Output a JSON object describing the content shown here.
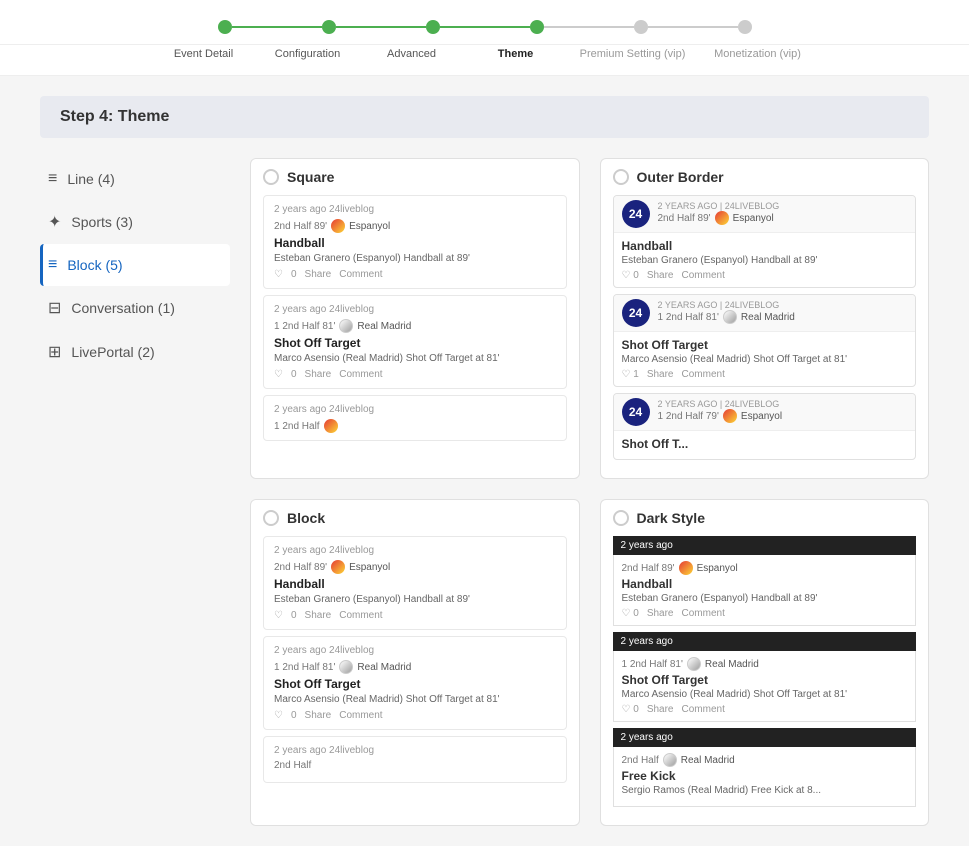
{
  "stepper": {
    "steps": [
      {
        "label": "Event Detail",
        "active": true,
        "connector": true,
        "connector_active": true
      },
      {
        "label": "Configuration",
        "active": true,
        "connector": true,
        "connector_active": true
      },
      {
        "label": "Advanced",
        "active": true,
        "connector": true,
        "connector_active": true
      },
      {
        "label": "Theme",
        "active": true,
        "connector": true,
        "connector_active": false
      },
      {
        "label": "Premium Setting (vip)",
        "active": false,
        "connector": true,
        "connector_active": false
      },
      {
        "label": "Monetization (vip)",
        "active": false,
        "connector": false
      }
    ]
  },
  "step_header": "Step 4: Theme",
  "sidebar": {
    "items": [
      {
        "icon": "≡",
        "label": "Line (4)",
        "active": false
      },
      {
        "icon": "✦",
        "label": "Sports (3)",
        "active": false
      },
      {
        "icon": "≡",
        "label": "Block (5)",
        "active": true
      },
      {
        "icon": "⊟",
        "label": "Conversation (1)",
        "active": false
      },
      {
        "icon": "⊞",
        "label": "LivePortal (2)",
        "active": false
      }
    ]
  },
  "themes": [
    {
      "id": "square",
      "name": "Square",
      "selected": false,
      "posts": [
        {
          "meta": "2 years ago   24liveblog",
          "half": "2nd Half 89'",
          "team": "Espanyol",
          "team_type": "espanyol",
          "title": "Handball",
          "desc": "Esteban Granero (Espanyol) Handball at 89'",
          "likes": "0",
          "actions": [
            "Share",
            "Comment"
          ]
        },
        {
          "meta": "2 years ago   24liveblog",
          "half": "1 2nd Half 81'",
          "team": "Real Madrid",
          "team_type": "rm",
          "title": "Shot Off Target",
          "desc": "Marco Asensio (Real Madrid) Shot Off Target at 81'",
          "likes": "0",
          "actions": [
            "Share",
            "Comment"
          ]
        },
        {
          "meta": "2 years ago   24liveblog",
          "half": "1 2nd Half",
          "team": "Espanyol",
          "team_type": "espanyol",
          "title": "...",
          "desc": "",
          "likes": "",
          "actions": []
        }
      ]
    },
    {
      "id": "outer-border",
      "name": "Outer Border",
      "selected": false,
      "posts": [
        {
          "badge": "24",
          "meta": "2 YEARS AGO | 24LIVEBLOG",
          "half": "2nd Half 89'",
          "team": "Espanyol",
          "team_type": "espanyol",
          "title": "Handball",
          "desc": "Esteban Granero (Espanyol) Handball at 89'",
          "likes": "0",
          "actions": [
            "Share",
            "Comment"
          ]
        },
        {
          "badge": "24",
          "meta": "2 YEARS AGO | 24LIVEBLOG",
          "half": "1 2nd Half 81'",
          "team": "Real Madrid",
          "team_type": "rm",
          "title": "Shot Off Target",
          "desc": "Marco Asensio (Real Madrid) Shot Off Target at 81'",
          "likes": "1",
          "actions": [
            "Share",
            "Comment"
          ]
        },
        {
          "badge": "24",
          "meta": "2 YEARS AGO | 24LIVEBLOG",
          "half": "1 2nd Half 79'",
          "team": "Espanyol",
          "team_type": "espanyol",
          "title": "Shot Off T...",
          "desc": "",
          "likes": "",
          "actions": []
        }
      ]
    },
    {
      "id": "block",
      "name": "Block",
      "selected": false,
      "posts": [
        {
          "meta": "2 years ago   24liveblog",
          "half": "2nd Half 89'",
          "team": "Espanyol",
          "team_type": "espanyol",
          "title": "Handball",
          "desc": "Esteban Granero (Espanyol) Handball at 89'",
          "likes": "0",
          "actions": [
            "Share",
            "Comment"
          ]
        },
        {
          "meta": "2 years ago   24liveblog",
          "half": "1 2nd Half 81'",
          "team": "Real Madrid",
          "team_type": "rm",
          "title": "Shot Off Target",
          "desc": "Marco Asensio (Real Madrid) Shot Off Target at 81'",
          "likes": "0",
          "actions": [
            "Share",
            "Comment"
          ]
        },
        {
          "meta": "2 years ago   24liveblog",
          "half": "2nd Half",
          "team": "",
          "team_type": "",
          "title": "...",
          "desc": "",
          "likes": "",
          "actions": []
        }
      ]
    },
    {
      "id": "dark-style",
      "name": "Dark Style",
      "selected": false,
      "posts": [
        {
          "header_bar": "2 years ago",
          "half": "2nd Half 89'",
          "team": "Espanyol",
          "team_type": "espanyol",
          "title": "Handball",
          "desc": "Esteban Granero (Espanyol) Handball at 89'",
          "likes": "0",
          "actions": [
            "Share",
            "Comment"
          ]
        },
        {
          "header_bar": "2 years ago",
          "half": "1 2nd Half 81'",
          "team": "Real Madrid",
          "team_type": "rm",
          "title": "Shot Off Target",
          "desc": "Marco Asensio (Real Madrid) Shot Off Target at 81'",
          "likes": "0",
          "actions": [
            "Share",
            "Comment"
          ]
        },
        {
          "header_bar": "2 years ago",
          "half": "2nd Half",
          "team": "Real Madrid",
          "team_type": "rm",
          "title": "Free Kick",
          "desc": "Sergio Ramos (Real Madrid) Free Kick at 8...",
          "likes": "",
          "actions": []
        }
      ]
    }
  ]
}
